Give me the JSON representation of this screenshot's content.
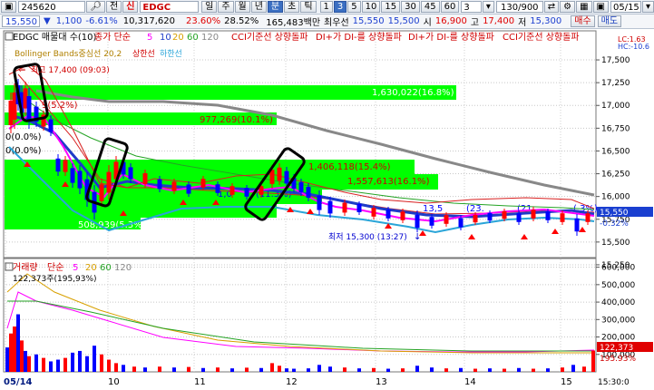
{
  "toolbar1": {
    "market_prefix": "▣",
    "code": "245620",
    "search_icon": "search-icon",
    "mode_label": "전",
    "badge": "신",
    "name": "EDGC",
    "periods": [
      "일",
      "주",
      "월",
      "년",
      "분",
      "초",
      "틱"
    ],
    "selected_period": "분",
    "intervals": [
      "1",
      "3",
      "5",
      "10",
      "15",
      "30",
      "45",
      "60"
    ],
    "selected_interval": "3",
    "count_value": "3",
    "page_info": "130/900",
    "date": "05/15"
  },
  "toolbar2": {
    "price": "15,550",
    "arrow": "▼",
    "change": "1,100",
    "change_pct": "-6.61%",
    "volume": "10,317,620",
    "ratio1": "23.60%",
    "ratio2": "28.52%",
    "amount": "165,483백만",
    "best_ask_label": "최우선",
    "best_ask1": "15,550",
    "best_ask2": "15,500",
    "open_label": "시",
    "open": "16,900",
    "high_label": "고",
    "high": "17,400",
    "low_label": "저",
    "low": "15,300",
    "buy_label": "매수",
    "sell_label": "매도"
  },
  "price_panel": {
    "title": "EDGC 매물대 수(10)",
    "ma_label": "종가 단순",
    "ma_periods": [
      "5",
      "10",
      "20",
      "60",
      "120"
    ],
    "signals": [
      "CCI기준선 상향돌파",
      "DI+가 DI-를 상향돌파",
      "DI+가 DI-를 상향돌파",
      "CCI기준선 상향돌파"
    ],
    "bands_label": "Bollinger Bands중심선 20,2",
    "bands_upper": "상한선",
    "bands_lower": "하한선",
    "high_marker": "최고 17,400 (09:03)",
    "low_marker": "최저 15,300 (13:27)",
    "profile_labels": [
      "1,630,022(16.8%)",
      "977,269(10.1%)",
      "1,406,118(15.4%)",
      "1,557,613(16.1%)",
      "508,939(5.3%)"
    ],
    "partial_labels": [
      "9(5.2%)",
      "0(0.0%)",
      "0(0.0%)",
      "1,0",
      "(11.3%)",
      "13,5",
      "(23.",
      "(21.",
      "(.3%)"
    ],
    "y_axis": [
      "17,500",
      "17,250",
      "17,000",
      "16,750",
      "16,500",
      "16,250",
      "16,000",
      "15,750",
      "15,500",
      "15,250"
    ],
    "lc_label": "LC:1.63",
    "hc_label": "HC:-10.6",
    "current_price_tag": "15,550",
    "current_pct_tag": "-0.32%"
  },
  "volume_panel": {
    "label": "거래량",
    "ma_label": "단순",
    "ma_periods": [
      "5",
      "20",
      "60",
      "120"
    ],
    "value_text": "122,373주(195,93%)",
    "y_axis": [
      "600,000",
      "500,000",
      "400,000",
      "300,000",
      "200,000",
      "100,000"
    ],
    "current_tag": "122,373",
    "current_pct": "195.93%"
  },
  "x_axis": {
    "labels": [
      "05/14",
      "10",
      "11",
      "12",
      "13",
      "14",
      "15"
    ],
    "time_label": "15:30:0"
  },
  "colors": {
    "toolbar_bg": "#eef2f7",
    "profile_green": "#00ff00",
    "up_red": "#ff0000",
    "down_blue": "#0000ff",
    "ma5": "#ff00ff",
    "ma10": "#1e3cc8",
    "ma20": "#d82020",
    "ma60": "#24a324",
    "ma120": "#888888",
    "bb_center": "#c0a000",
    "bb_lower": "#2aa5d8"
  }
}
